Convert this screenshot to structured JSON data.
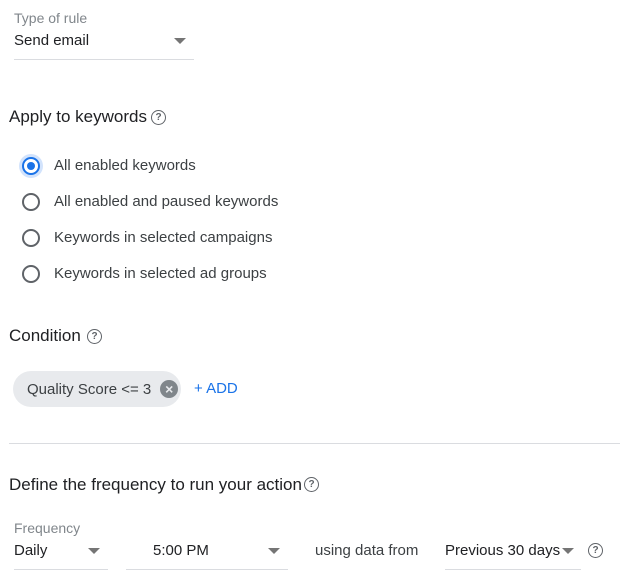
{
  "rule_type": {
    "label": "Type of rule",
    "value": "Send email",
    "caret_icon": "dropdown-caret-icon"
  },
  "apply_to_keywords": {
    "title": "Apply to keywords",
    "help_icon": "help-circle-icon",
    "options": [
      {
        "label": "All enabled keywords",
        "selected": true
      },
      {
        "label": "All enabled and paused keywords",
        "selected": false
      },
      {
        "label": "Keywords in selected campaigns",
        "selected": false
      },
      {
        "label": "Keywords in selected ad groups",
        "selected": false
      }
    ]
  },
  "condition": {
    "title": "Condition",
    "help_icon": "help-circle-icon",
    "chip_label": "Quality Score <= 3",
    "chip_remove_icon": "remove-chip-icon",
    "add_label": "+ ADD"
  },
  "frequency": {
    "title": "Define the frequency to run your action",
    "help_icon": "help-circle-icon",
    "frequency_label": "Frequency",
    "frequency_value": "Daily",
    "time_value": "5:00 PM",
    "using_text": "using data from",
    "range_value": "Previous 30 days"
  },
  "colors": {
    "accent": "#1a73e8",
    "chip_bg": "#e8eaed",
    "divider": "#dadce0"
  }
}
